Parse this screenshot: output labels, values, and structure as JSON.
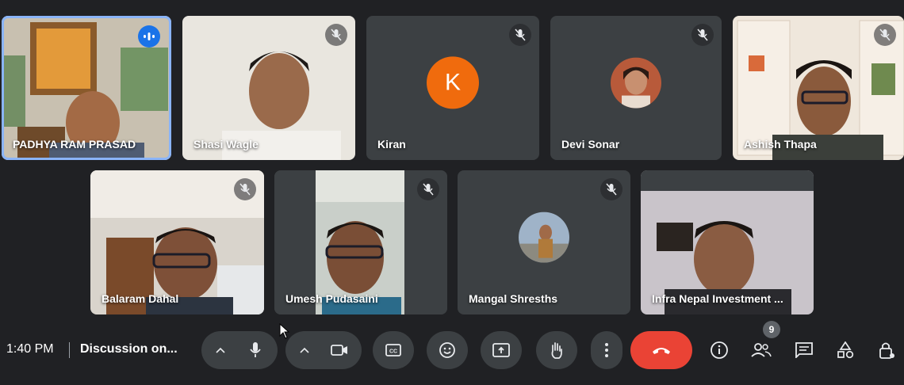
{
  "participants": [
    {
      "name": "PADHYA RAM PRASAD",
      "state": "speaking",
      "active": true
    },
    {
      "name": "Shasi Wagle",
      "state": "muted"
    },
    {
      "name": "Kiran",
      "state": "muted",
      "initial": "K",
      "avatar_color": "#f06b0d"
    },
    {
      "name": "Devi Sonar",
      "state": "muted"
    },
    {
      "name": "Ashish Thapa",
      "state": "muted"
    },
    {
      "name": "Balaram Dahal",
      "state": "muted"
    },
    {
      "name": "Umesh Pudasaini",
      "state": "muted"
    },
    {
      "name": "Mangal Shresths",
      "state": "muted"
    },
    {
      "name": "Infra Nepal Investment ...",
      "state": "muted"
    }
  ],
  "toolbar": {
    "time": "1:40 PM",
    "meeting_title": "Discussion on...",
    "people_count": "9",
    "icons": [
      "chevron-up-icon",
      "microphone-icon",
      "chevron-up-icon",
      "camera-icon",
      "captions-icon",
      "emoji-icon",
      "present-icon",
      "raise-hand-icon",
      "more-vert-icon",
      "end-call-icon",
      "info-icon",
      "people-icon",
      "chat-icon",
      "activities-icon",
      "host-controls-icon"
    ]
  },
  "colors": {
    "background": "#202124",
    "tile": "#3c4043",
    "active_border": "#8ab4f8",
    "end_call": "#ea4335",
    "speaking": "#1a73e8"
  }
}
